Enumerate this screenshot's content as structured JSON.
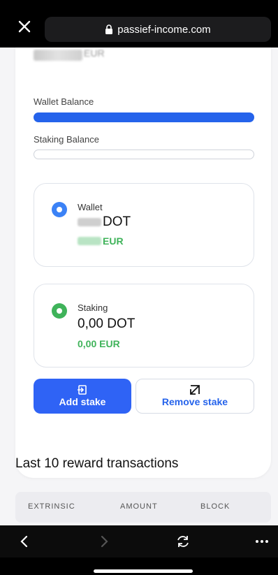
{
  "browser": {
    "url": "passief-income.com"
  },
  "balances": {
    "wallet_label": "Wallet Balance",
    "wallet_fraction": 1.0,
    "staking_label": "Staking Balance",
    "staking_fraction": 0.0,
    "hidden_amount_suffix": "EUR"
  },
  "wallet": {
    "title": "Wallet",
    "amount_unit": "DOT",
    "fiat_unit": "EUR"
  },
  "staking": {
    "title": "Staking",
    "amount": "0,00 DOT",
    "fiat": "0,00 EUR"
  },
  "actions": {
    "add_label": "Add stake",
    "remove_label": "Remove stake"
  },
  "transactions": {
    "title": "Last 10 reward transactions",
    "columns": [
      "EXTRINSIC",
      "AMOUNT",
      "BLOCK"
    ]
  },
  "colors": {
    "primary": "#2f63f5",
    "success": "#3fb35a"
  }
}
